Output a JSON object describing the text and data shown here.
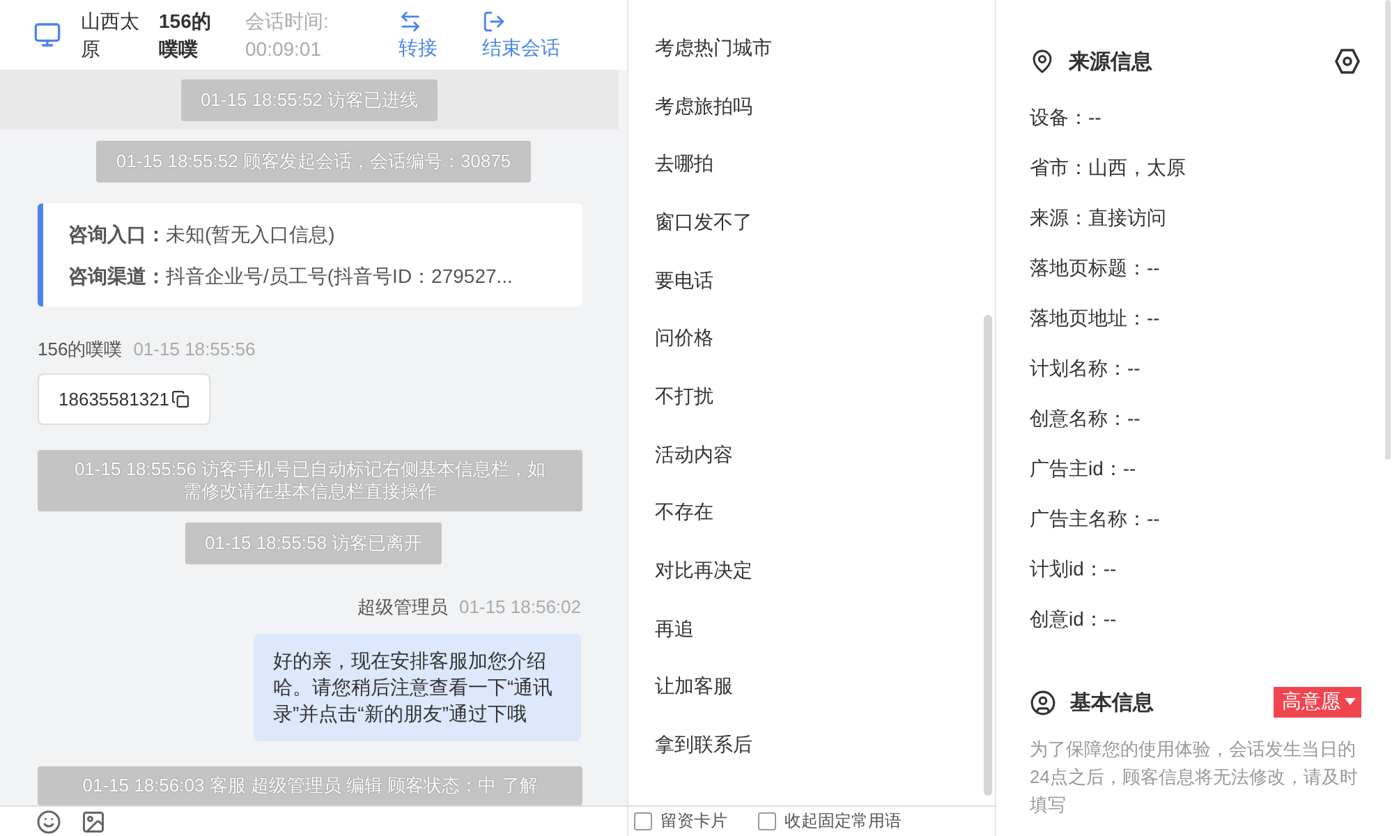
{
  "header": {
    "location": "山西太原",
    "visitor": "156的噗噗",
    "duration_label": "会话时间:",
    "duration": "00:09:01",
    "actions": [
      {
        "kind": "transfer",
        "label": "转接"
      },
      {
        "kind": "end",
        "label": "结束会话"
      }
    ]
  },
  "messages": [
    {
      "kind": "banner",
      "text": "01-15 18:55:52 访客已进线"
    },
    {
      "kind": "system",
      "text": "01-15 18:55:52 顾客发起会话，会话编号：30875"
    },
    {
      "kind": "info",
      "rows": [
        {
          "label": "咨询入口：",
          "value": "未知(暂无入口信息)"
        },
        {
          "label": "咨询渠道：",
          "value": "抖音企业号/员工号(抖音号ID：279527..."
        }
      ]
    },
    {
      "kind": "visitor",
      "name": "156的噗噗",
      "time": "01-15 18:55:56",
      "text": "18635581321"
    },
    {
      "kind": "wide",
      "text": "01-15 18:55:56 访客手机号已自动标记右侧基本信息栏，如需修改请在基本信息栏直接操作"
    },
    {
      "kind": "system",
      "text": "01-15 18:55:58 访客已离开"
    },
    {
      "kind": "agent",
      "name": "超级管理员",
      "time": "01-15 18:56:02",
      "text": "好的亲，现在安排客服加您介绍哈。请您稍后注意查看一下“通讯录”并点击“新的朋友”通过下哦"
    },
    {
      "kind": "wide",
      "text": "01-15 18:56:03 客服 超级管理员 编辑 顾客状态：中 了解"
    }
  ],
  "quick_replies": [
    "考虑热门城市",
    "考虑旅拍吗",
    "去哪拍",
    "窗口发不了",
    "要电话",
    "问价格",
    "不打扰",
    "活动内容",
    "不存在",
    "对比再决定",
    "再追",
    "让加客服",
    "拿到联系后"
  ],
  "options": [
    {
      "label": "留资卡片",
      "checked": false
    },
    {
      "label": "收起固定常用语",
      "checked": false
    }
  ],
  "source_info": {
    "title": "来源信息",
    "fields": [
      "设备：--",
      "省市：山西，太原",
      "来源：直接访问",
      "落地页标题：--",
      "落地页地址：--",
      "计划名称：--",
      "创意名称：--",
      "广告主id：--",
      "广告主名称：--",
      "计划id：--",
      "创意id：--"
    ]
  },
  "basic_info": {
    "title": "基本信息",
    "tag": "高意愿",
    "notice": "为了保障您的使用体验，会话发生当日的24点之后，顾客信息将无法修改，请及时填写"
  }
}
